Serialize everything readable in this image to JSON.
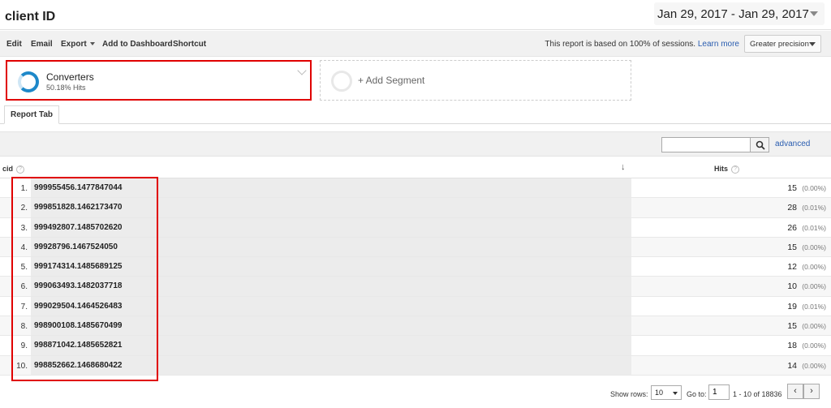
{
  "header": {
    "title": "client ID",
    "date_range": "Jan 29, 2017 - Jan 29, 2017"
  },
  "toolbar": {
    "edit": "Edit",
    "email": "Email",
    "export": "Export",
    "add_to_dashboard": "Add to Dashboard",
    "shortcut": "Shortcut",
    "report_note": "This report is based on 100% of sessions.",
    "learn_more": "Learn more",
    "precision": "Greater precision"
  },
  "segments": {
    "active": {
      "name": "Converters",
      "sub": "50.18% Hits"
    },
    "add_label": "+ Add Segment"
  },
  "tabs": [
    {
      "label": "Report Tab"
    }
  ],
  "search": {
    "placeholder": "",
    "advanced": "advanced"
  },
  "table": {
    "columns": {
      "dimension": "cid",
      "metric": "Hits"
    },
    "rows": [
      {
        "index": "1.",
        "cid": "999955456.1477847044",
        "hits": "15",
        "pct": "(0.00%)"
      },
      {
        "index": "2.",
        "cid": "999851828.1462173470",
        "hits": "28",
        "pct": "(0.01%)"
      },
      {
        "index": "3.",
        "cid": "999492807.1485702620",
        "hits": "26",
        "pct": "(0.01%)"
      },
      {
        "index": "4.",
        "cid": "99928796.1467524050",
        "hits": "15",
        "pct": "(0.00%)"
      },
      {
        "index": "5.",
        "cid": "999174314.1485689125",
        "hits": "12",
        "pct": "(0.00%)"
      },
      {
        "index": "6.",
        "cid": "999063493.1482037718",
        "hits": "10",
        "pct": "(0.00%)"
      },
      {
        "index": "7.",
        "cid": "999029504.1464526483",
        "hits": "19",
        "pct": "(0.01%)"
      },
      {
        "index": "8.",
        "cid": "998900108.1485670499",
        "hits": "15",
        "pct": "(0.00%)"
      },
      {
        "index": "9.",
        "cid": "998871042.1485652821",
        "hits": "18",
        "pct": "(0.00%)"
      },
      {
        "index": "10.",
        "cid": "998852662.1468680422",
        "hits": "14",
        "pct": "(0.00%)"
      }
    ]
  },
  "pager": {
    "show_rows_label": "Show rows:",
    "show_rows_value": "10",
    "goto_label": "Go to:",
    "goto_value": "1",
    "range": "1 - 10 of 18836",
    "prev": "‹",
    "next": "›"
  },
  "colors": {
    "highlight": "#e00000",
    "segment_ring": "#1e88c9",
    "link": "#2a5db0"
  }
}
